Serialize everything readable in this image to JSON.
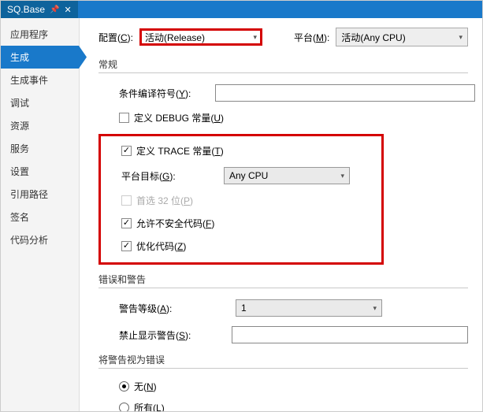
{
  "tab": {
    "title": "SQ.Base"
  },
  "sidebar": {
    "items": [
      {
        "label": "应用程序"
      },
      {
        "label": "生成"
      },
      {
        "label": "生成事件"
      },
      {
        "label": "调试"
      },
      {
        "label": "资源"
      },
      {
        "label": "服务"
      },
      {
        "label": "设置"
      },
      {
        "label": "引用路径"
      },
      {
        "label": "签名"
      },
      {
        "label": "代码分析"
      }
    ],
    "selected": 1
  },
  "top": {
    "config_label_pre": "配置(",
    "config_label_u": "C",
    "config_label_post": "):",
    "config_value": "活动(Release)",
    "platform_label_pre": "平台(",
    "platform_label_u": "M",
    "platform_label_post": "):",
    "platform_value": "活动(Any CPU)"
  },
  "sections": {
    "general": "常规",
    "errwarn": "错误和警告",
    "treat": "将警告视为错误"
  },
  "general": {
    "cond_pre": "条件编译符号(",
    "cond_u": "Y",
    "cond_post": "):",
    "debug_pre": "定义 DEBUG 常量(",
    "debug_u": "U",
    "debug_post": ")",
    "trace_pre": "定义 TRACE 常量(",
    "trace_u": "T",
    "trace_post": ")",
    "ptarget_pre": "平台目标(",
    "ptarget_u": "G",
    "ptarget_post": "):",
    "ptarget_value": "Any CPU",
    "prefer32_pre": "首选 32 位(",
    "prefer32_u": "P",
    "prefer32_post": ")",
    "unsafe_pre": "允许不安全代码(",
    "unsafe_u": "F",
    "unsafe_post": ")",
    "optimize_pre": "优化代码(",
    "optimize_u": "Z",
    "optimize_post": ")"
  },
  "errwarn": {
    "level_pre": "警告等级(",
    "level_u": "A",
    "level_post": "):",
    "level_value": "1",
    "suppress_pre": "禁止显示警告(",
    "suppress_u": "S",
    "suppress_post": "):"
  },
  "treat": {
    "none_pre": "无(",
    "none_u": "N",
    "none_post": ")",
    "all_pre": "所有(",
    "all_u": "L",
    "all_post": ")"
  }
}
